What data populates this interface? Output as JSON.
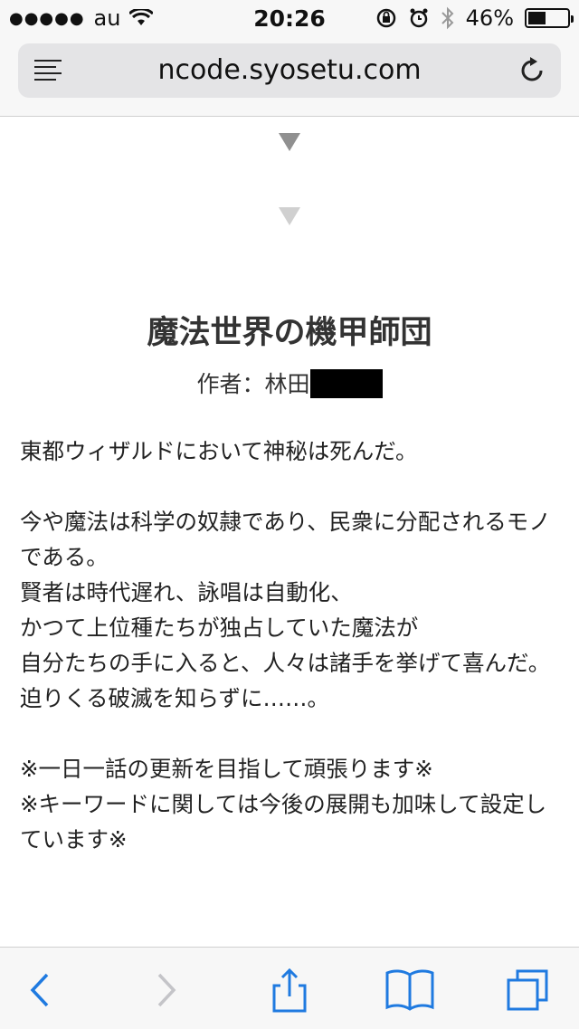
{
  "status_bar": {
    "carrier": "au",
    "time": "20:26",
    "battery": "46%",
    "battery_level": 0.46
  },
  "browser": {
    "url": "ncode.syosetu.com"
  },
  "novel": {
    "title": "魔法世界の機甲師団",
    "author_label": "作者：林田",
    "synopsis": [
      "東都ウィザルドにおいて神秘は死んだ。",
      "",
      "今や魔法は科学の奴隷であり、民衆に分配されるモノである。",
      "賢者は時代遅れ、詠唱は自動化、",
      "かつて上位種たちが独占していた魔法が",
      "自分たちの手に入ると、人々は諸手を挙げて喜んだ。",
      "迫りくる破滅を知らずに……。",
      "",
      "※一日一話の更新を目指して頑張ります※",
      "※キーワードに関しては今後の展開も加味して設定しています※"
    ]
  },
  "icons": {
    "reader": "reader-icon",
    "reload": "reload-icon",
    "back": "back-chevron-icon",
    "forward": "forward-chevron-icon",
    "share": "share-icon",
    "bookmarks": "book-icon",
    "tabs": "tabs-icon"
  },
  "colors": {
    "accent": "#1f7ae0",
    "disabled": "#c4c4c8"
  }
}
